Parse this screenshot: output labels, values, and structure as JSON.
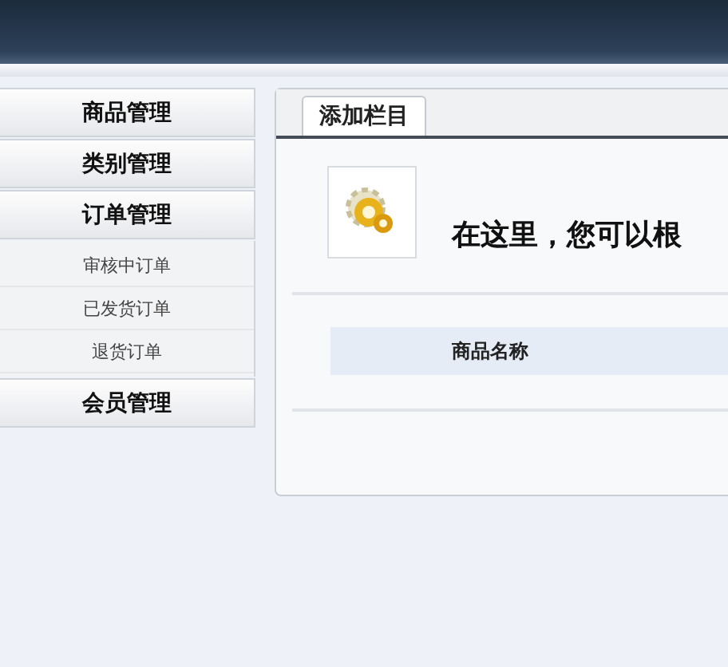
{
  "sidebar": {
    "items": [
      {
        "label": "商品管理"
      },
      {
        "label": "类别管理"
      },
      {
        "label": "订单管理",
        "children": [
          {
            "label": "审核中订单"
          },
          {
            "label": "已发货订单"
          },
          {
            "label": "退货订单"
          }
        ]
      },
      {
        "label": "会员管理"
      }
    ]
  },
  "main": {
    "tabs": [
      {
        "label": "添加栏目",
        "selected": true
      }
    ],
    "heading": "在这里，您可以根",
    "table": {
      "columns": [
        "商品名称"
      ]
    }
  }
}
